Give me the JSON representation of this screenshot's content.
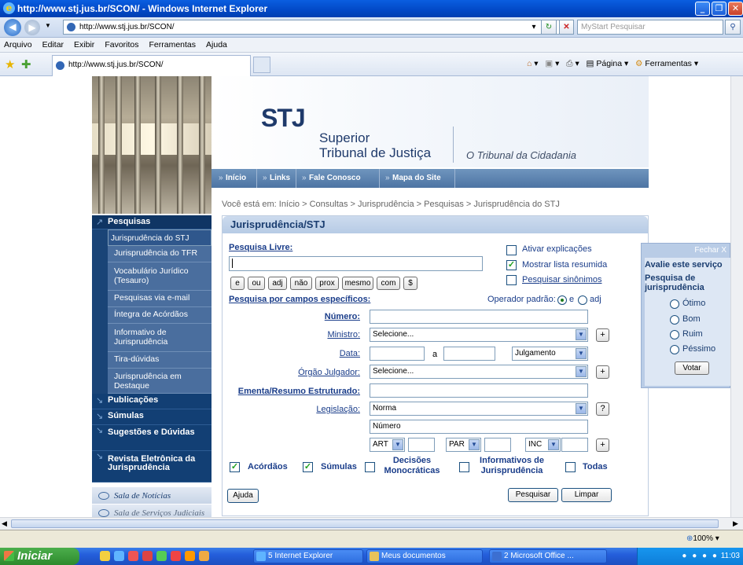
{
  "window": {
    "title": "http://www.stj.jus.br/SCON/ - Windows Internet Explorer"
  },
  "address": {
    "url": "http://www.stj.jus.br/SCON/",
    "search_placeholder": "MyStart Pesquisar"
  },
  "menu": [
    "Arquivo",
    "Editar",
    "Exibir",
    "Favoritos",
    "Ferramentas",
    "Ajuda"
  ],
  "tab": {
    "title": "http://www.stj.jus.br/SCON/"
  },
  "favtools": {
    "pagina": "Página",
    "ferramentas": "Ferramentas"
  },
  "header": {
    "logo": "STJ",
    "superior": "Superior",
    "tribunal": "Tribunal de Justiça",
    "slogan": "O Tribunal da Cidadania"
  },
  "topnav": [
    "Início",
    "Links",
    "Fale Conosco",
    "Mapa do Site"
  ],
  "breadcrumb": "Você está em: Início > Consultas > Jurisprudência > Pesquisas > Jurisprudência do STJ",
  "sidebar": {
    "pesquisas": "Pesquisas",
    "items": [
      "Jurisprudência do STJ",
      "Jurisprudência do TFR",
      "Vocabulário Jurídico (Tesauro)",
      "Pesquisas via e-mail",
      "Íntegra de Acórdãos",
      "Informativo de Jurisprudência",
      "Tira-dúvidas",
      "Jurisprudência em Destaque"
    ],
    "sections": [
      "Publicações",
      "Súmulas",
      "Sugestões e Dúvidas",
      "Revista Eletrônica da Jurisprudência"
    ],
    "extras": [
      "Sala de Notícias",
      "Sala de Serviços Judiciais"
    ]
  },
  "panel": {
    "title": "Jurisprudência/STJ",
    "pesquisa_livre": "Pesquisa Livre:",
    "operators": [
      "e",
      "ou",
      "adj",
      "não",
      "prox",
      "mesmo",
      "com",
      "$"
    ],
    "ativar": "Ativar explicações",
    "mostrar": "Mostrar lista resumida",
    "sinonimos": "Pesquisar sinônimos",
    "campos": "Pesquisa por campos específicos:",
    "operador_padrao": "Operador padrão:",
    "op_e": "e",
    "op_adj": "adj",
    "numero": "Número:",
    "ministro": "Ministro:",
    "ministro_value": "Selecione...",
    "data": "Data:",
    "data_a": "a",
    "data_type": "Julgamento",
    "orgao": "Órgão Julgador:",
    "orgao_value": "Selecione...",
    "ementa": "Ementa/Resumo Estruturado:",
    "legislacao": "Legislação:",
    "leg_value": "Norma",
    "numero_placeholder": "Número",
    "art": "ART",
    "par": "PAR",
    "inc": "INC",
    "types": [
      "Acórdãos",
      "Súmulas",
      "Decisões Monocráticas",
      "Informativos de Jurisprudência",
      "Todas"
    ],
    "ajuda": "Ajuda",
    "pesquisar": "Pesquisar",
    "limpar": "Limpar"
  },
  "survey": {
    "fechar": "Fechar X",
    "title": "Avalie este serviço",
    "subtitle": "Pesquisa de jurisprudência",
    "options": [
      "Ótimo",
      "Bom",
      "Ruim",
      "Péssimo"
    ],
    "votar": "Votar"
  },
  "status": {
    "zoom": "100%"
  },
  "taskbar": {
    "start": "Iniciar",
    "items": [
      "5 Internet Explorer",
      "Meus documentos",
      "2 Microsoft Office ..."
    ],
    "clock": "11:03"
  }
}
